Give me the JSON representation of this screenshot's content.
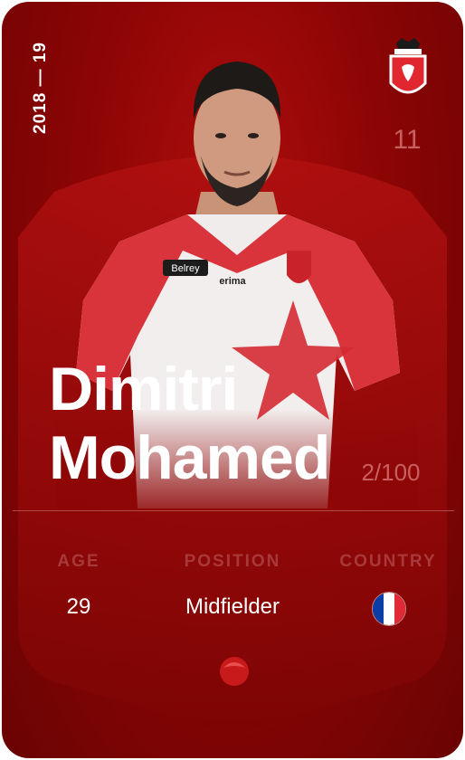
{
  "card": {
    "season": "2018 — 19",
    "shirt_number": "11",
    "first_name": "Dimitri",
    "last_name": "Mohamed",
    "serial": "2/100"
  },
  "stats": {
    "age_label": "AGE",
    "age_value": "29",
    "position_label": "POSITION",
    "position_value": "Midfielder",
    "country_label": "COUNTRY",
    "country_flag": "france-flag-icon"
  },
  "icons": {
    "club": "royal-excel-mouscron-badge",
    "brand": "sorare-logo-icon"
  },
  "colors": {
    "card_red": "#8d0505",
    "accent_label": "#a93838",
    "muted_number": "#c86060",
    "text": "#ffffff"
  }
}
